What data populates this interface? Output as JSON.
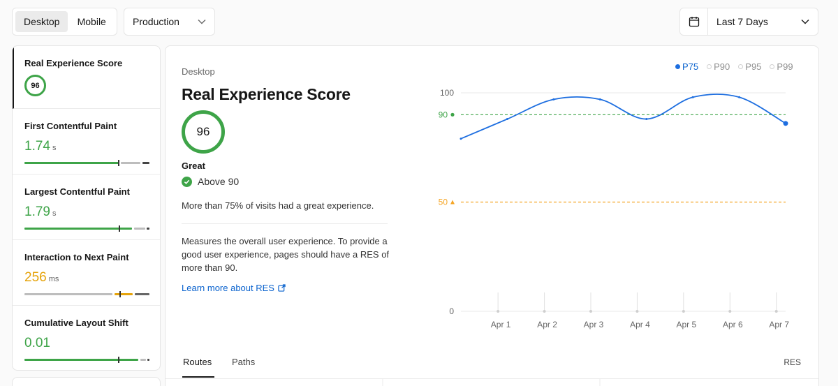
{
  "toolbar": {
    "device_tabs": [
      "Desktop",
      "Mobile"
    ],
    "environment": "Production",
    "date_range": "Last 7 Days"
  },
  "sidebar": {
    "metrics": [
      {
        "title": "Real Experience Score",
        "value": "96",
        "unit": ""
      },
      {
        "title": "First Contentful Paint",
        "value": "1.74",
        "unit": "s"
      },
      {
        "title": "Largest Contentful Paint",
        "value": "1.79",
        "unit": "s"
      },
      {
        "title": "Interaction to Next Paint",
        "value": "256",
        "unit": "ms"
      },
      {
        "title": "Cumulative Layout Shift",
        "value": "0.01",
        "unit": ""
      }
    ]
  },
  "main": {
    "device": "Desktop",
    "title": "Real Experience Score",
    "score": "96",
    "rating": "Great",
    "threshold_text": "Above 90",
    "summary": "More than 75% of visits had a great experience.",
    "description": "Measures the overall user experience. To provide a good user experience, pages should have a RES of more than 90.",
    "learn_more": "Learn more about RES",
    "legend": [
      "P75",
      "P90",
      "P95",
      "P99"
    ],
    "tabs": [
      "Routes",
      "Paths"
    ],
    "column_label": "RES"
  },
  "chart_data": {
    "type": "line",
    "categories": [
      "Apr 1",
      "Apr 2",
      "Apr 3",
      "Apr 4",
      "Apr 5",
      "Apr 6",
      "Apr 7"
    ],
    "series": [
      {
        "name": "P75",
        "x": [
          0,
          1,
          2,
          3,
          4,
          5,
          6,
          7
        ],
        "values": [
          79,
          88,
          97,
          97,
          88,
          98,
          98,
          86
        ]
      }
    ],
    "ylim": [
      0,
      100
    ],
    "yticks": [
      "100",
      "0"
    ],
    "reference_lines": [
      {
        "label": "90",
        "value": 90,
        "color": "#3ea448"
      },
      {
        "label": "50",
        "value": 50,
        "color": "#f5a524"
      }
    ],
    "colors": {
      "series": "#1d6ee0",
      "grid": "#e8e8e8"
    }
  }
}
